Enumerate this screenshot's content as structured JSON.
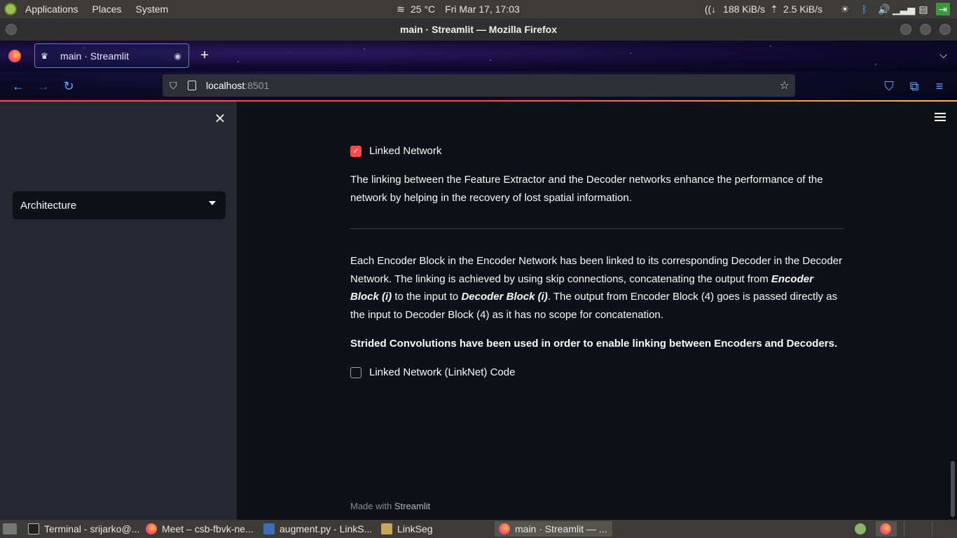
{
  "top_panel": {
    "menus": [
      "Applications",
      "Places",
      "System"
    ],
    "weather": "25 °C",
    "datetime": "Fri Mar 17, 17:03",
    "net_down": "188 KiB/s",
    "net_up": "2.5 KiB/s"
  },
  "window": {
    "title": "main · Streamlit — Mozilla Firefox"
  },
  "tabs": [
    {
      "label": "main · Streamlit"
    }
  ],
  "url": {
    "host": "localhost",
    "port": ":8501"
  },
  "sidebar": {
    "select_value": "Architecture"
  },
  "main": {
    "checkbox_linked": {
      "label": "Linked Network",
      "checked": true
    },
    "para1": "The linking between the Feature Extractor and the Decoder networks enhance the performance of the network by helping in the recovery of lost spatial information.",
    "para2_a": "Each Encoder Block in the Encoder Network has been linked to its corresponding Decoder in the Decoder Network. The linking is achieved by using skip connections, concatenating the output from ",
    "para2_em1": "Encoder Block (i)",
    "para2_b": " to the input to ",
    "para2_em2": "Decoder Block (i)",
    "para2_c": ". The output from Encoder Block (4) goes is passed directly as the input to Decoder Block (4) as it has no scope for concatenation.",
    "bold_note": "Strided Convolutions have been used in order to enable linking between Encoders and Decoders.",
    "checkbox_code": {
      "label": "Linked Network (LinkNet) Code",
      "checked": false
    },
    "footer_prefix": "Made with ",
    "footer_brand": "Streamlit"
  },
  "taskbar": {
    "items": [
      {
        "label": "Terminal - srijarko@..."
      },
      {
        "label": "Meet – csb-fbvk-ne..."
      },
      {
        "label": "augment.py - LinkS..."
      },
      {
        "label": "LinkSeg"
      },
      {
        "label": "main · Streamlit — ..."
      }
    ]
  },
  "colors": {
    "accent": "#ff4b4b",
    "sidebar_bg": "#262730",
    "main_bg": "#0e1117"
  }
}
